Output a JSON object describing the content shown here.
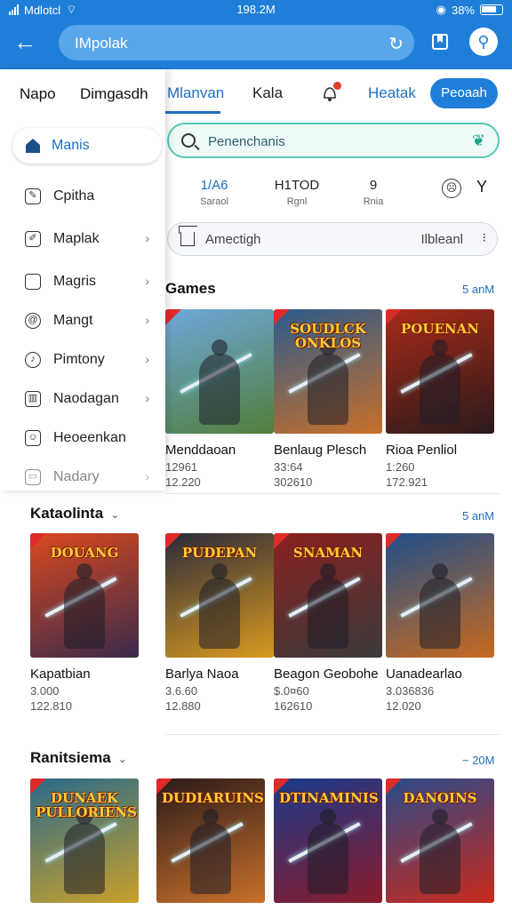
{
  "status_bar": {
    "carrier": "Mdlotcl",
    "time": "198.2M",
    "battery": "38%"
  },
  "app_bar": {
    "url_text": "IMpolak"
  },
  "tabs": [
    {
      "label": "Mlanvan",
      "active": true
    },
    {
      "label": "Kala"
    },
    {
      "label": "Heatak"
    },
    {
      "label": "Peoaah"
    }
  ],
  "search": {
    "placeholder": "Penenchanis"
  },
  "stats": [
    {
      "value": "1/A6",
      "label": "Saraol"
    },
    {
      "value": "H1TOD",
      "label": "Rgnl"
    },
    {
      "value": "9",
      "label": "Rnia"
    }
  ],
  "address": {
    "left": "Amectigh",
    "right": "Ilbleanl"
  },
  "drawer": {
    "tabs": [
      "Napo",
      "Dimgasdh"
    ],
    "selected": "Manis",
    "items": [
      {
        "label": "Cpitha",
        "icon": "puzzle-icon",
        "glyph": "✎",
        "arrow": false
      },
      {
        "label": "Maplak",
        "icon": "pen-icon",
        "glyph": "✐",
        "arrow": true
      },
      {
        "label": "Magris",
        "icon": "square-icon",
        "glyph": "",
        "arrow": true
      },
      {
        "label": "Mangt",
        "icon": "at-icon",
        "glyph": "@",
        "arrow": true
      },
      {
        "label": "Pimtony",
        "icon": "music-icon",
        "glyph": "♪",
        "arrow": true
      },
      {
        "label": "Naodagan",
        "icon": "barcode-icon",
        "glyph": "▥",
        "arrow": true
      },
      {
        "label": "Heoeenkan",
        "icon": "image-icon",
        "glyph": "☺",
        "arrow": false
      },
      {
        "label": "Nadary",
        "icon": "folder-icon",
        "glyph": "▭",
        "arrow": true
      }
    ]
  },
  "sections": [
    {
      "title": "Games",
      "meta": "5 anM"
    },
    {
      "title": "Kataolinta",
      "meta": "5 anM"
    },
    {
      "title": "Ranitsiema",
      "meta": "~ 20M"
    }
  ],
  "row1": [
    {
      "name": "Menddaoan",
      "l1": "12961",
      "l2": "12.220",
      "art_title": "",
      "c1": "#6fa8dc",
      "c2": "#4f7f3a"
    },
    {
      "name": "Benlaug Plesch",
      "l1": "33:64",
      "l2": "302610",
      "art_title": "SOUDLCK ONKLOS",
      "c1": "#2c5a8a",
      "c2": "#c9702a"
    },
    {
      "name": "Rioa Penliol",
      "l1": "1:260",
      "l2": "172.921",
      "art_title": "POUENAN",
      "c1": "#a82a18",
      "c2": "#2a1a1a"
    }
  ],
  "row2": [
    {
      "name": "Kapatbian",
      "l1": "3.000",
      "l2": "122.810",
      "art_title": "DOUANG",
      "c1": "#d9481f",
      "c2": "#3a2a4a"
    },
    {
      "name": "Barlya Naoa",
      "l1": "3.6.60",
      "l2": "12.880",
      "art_title": "PUDEPAN",
      "c1": "#2a2a3a",
      "c2": "#d99a1f"
    },
    {
      "name": "Beagon Geobohe",
      "l1": "$.0¤60",
      "l2": "162610",
      "art_title": "SNAMAN",
      "c1": "#8a2020",
      "c2": "#3a3a3a"
    },
    {
      "name": "Uanadearlao",
      "l1": "3.036836",
      "l2": "12.020",
      "art_title": "",
      "c1": "#1f4f8a",
      "c2": "#c96a1f"
    }
  ],
  "row3": [
    {
      "art_title": "DUNAEK PULLORIENS",
      "c1": "#2a6a8a",
      "c2": "#c9a02a"
    },
    {
      "art_title": "DUDIARUINS",
      "c1": "#2a1a1a",
      "c2": "#c9702a"
    },
    {
      "art_title": "DTINAMINIS",
      "c1": "#1a3a8a",
      "c2": "#8a1a2a"
    },
    {
      "art_title": "DANOINS",
      "c1": "#2a4a8a",
      "c2": "#c92a1a"
    }
  ]
}
